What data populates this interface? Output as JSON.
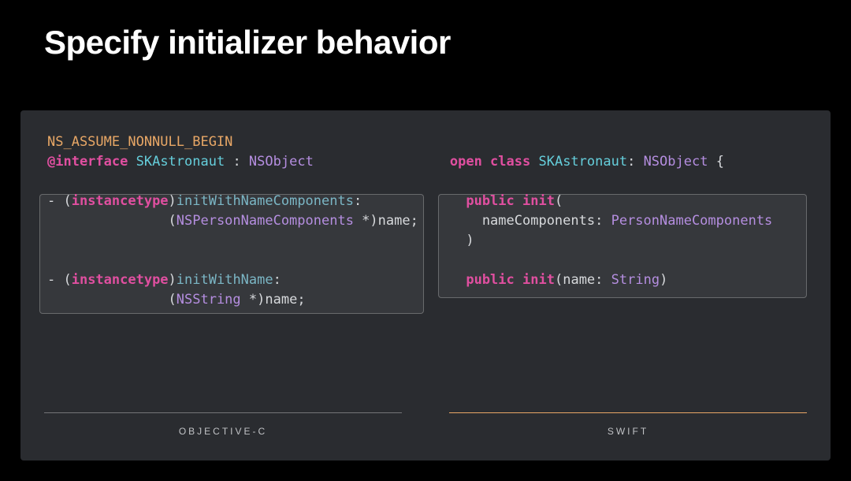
{
  "title": "Specify initializer behavior",
  "objc": {
    "macro": "NS_ASSUME_NONNULL_BEGIN",
    "kw_interface": "@interface",
    "classname": "SKAstronaut",
    "colon": " : ",
    "super": "NSObject",
    "m1_dash": "- (",
    "m1_instancetype": "instancetype",
    "m1_paren_close": ")",
    "m1_method": "initWithNameComponents",
    "m1_colon": ":",
    "m1_line2_pad": "               (",
    "m1_type": "NSPersonNameComponents",
    "m1_star": " *)",
    "m1_param": "name",
    "m1_semi": ";",
    "m2_dash": "- (",
    "m2_instancetype": "instancetype",
    "m2_paren_close": ")",
    "m2_method": "initWithName",
    "m2_colon": ":",
    "m2_line2_pad": "               (",
    "m2_type": "NSString",
    "m2_star": " *)",
    "m2_param": "name",
    "m2_semi": ";"
  },
  "swift": {
    "kw_open": "open",
    "kw_class": " class",
    "sp1": " ",
    "classname": "SKAstronaut",
    "colon_sp": ": ",
    "super": "NSObject",
    "brace": " {",
    "m1_indent": "  ",
    "m1_public": "public",
    "m1_sp": " ",
    "m1_init": "init",
    "m1_open": "(",
    "m1_line2_pad": "    ",
    "m1_param": "nameComponents",
    "m1_colon_sp": ": ",
    "m1_type": "PersonNameComponents",
    "m1_line3_pad": "  ",
    "m1_close": ")",
    "m2_indent": "  ",
    "m2_public": "public",
    "m2_sp": " ",
    "m2_init": "init",
    "m2_open": "(",
    "m2_param": "name",
    "m2_colon_sp": ": ",
    "m2_type": "String",
    "m2_close": ")"
  },
  "footer": {
    "left": "OBJECTIVE-C",
    "right": "SWIFT"
  }
}
